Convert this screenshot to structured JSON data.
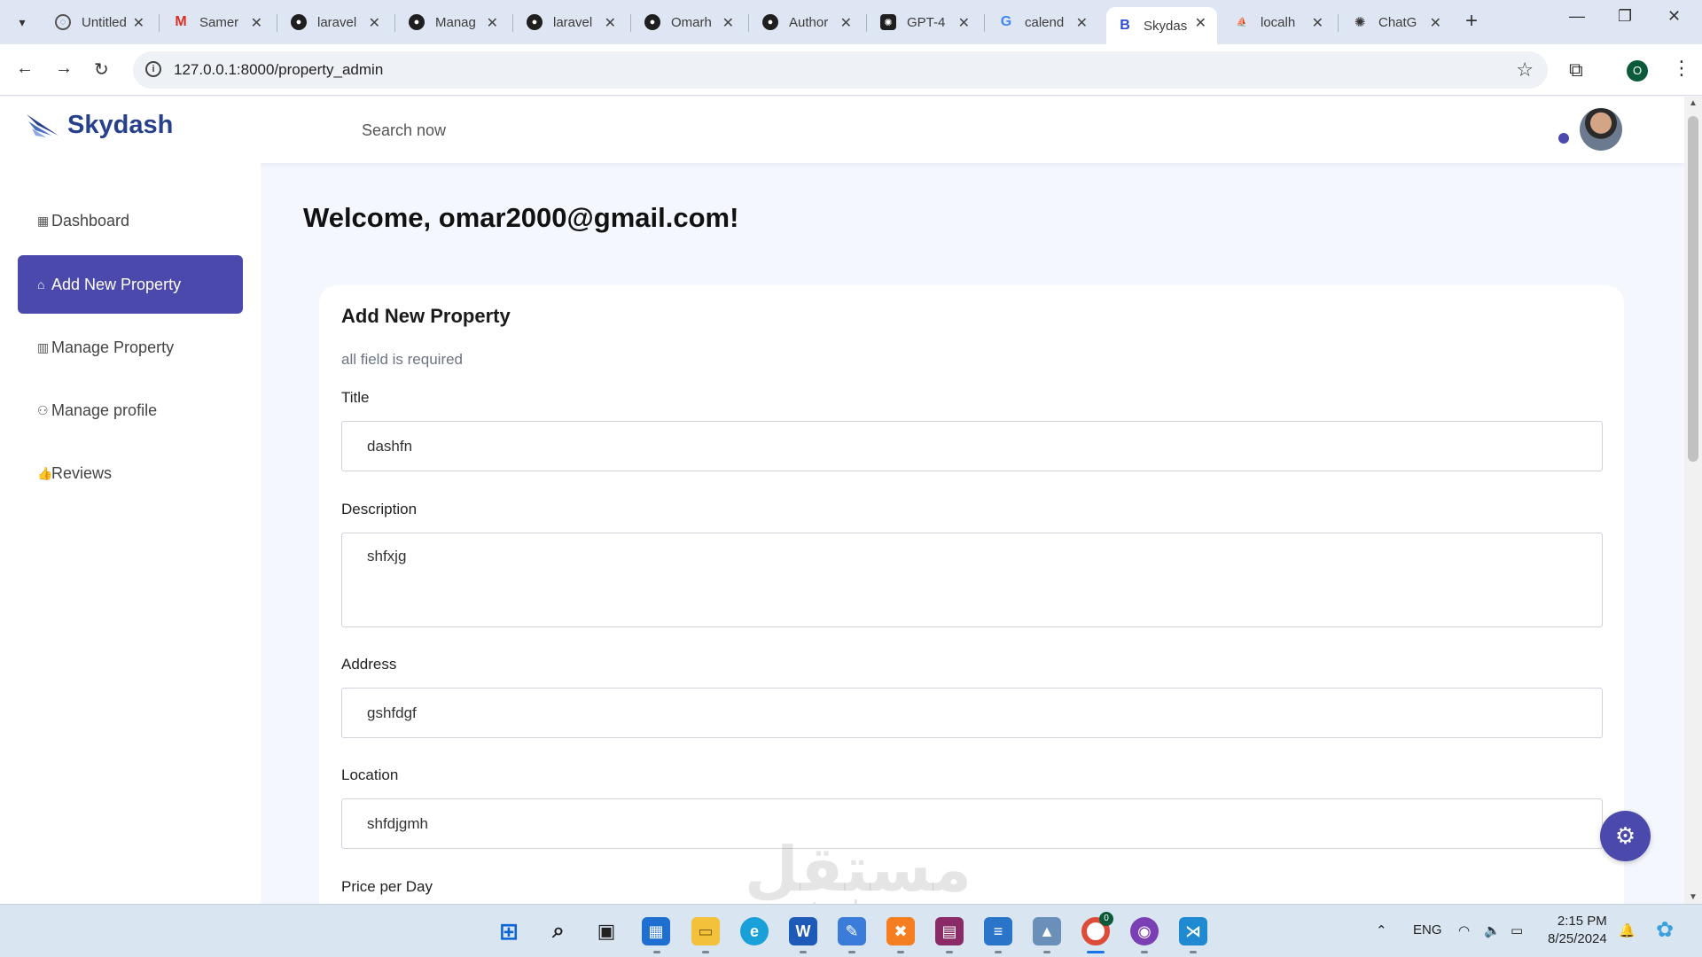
{
  "browser": {
    "tabs": [
      {
        "label": "Untitled",
        "icon": "page-icon"
      },
      {
        "label": "Samer",
        "icon": "gmail-icon"
      },
      {
        "label": "laravel",
        "icon": "github-icon"
      },
      {
        "label": "Manag",
        "icon": "github-icon"
      },
      {
        "label": "laravel",
        "icon": "github-icon"
      },
      {
        "label": "Omarh",
        "icon": "github-icon"
      },
      {
        "label": "Author",
        "icon": "github-icon"
      },
      {
        "label": "GPT-4",
        "icon": "openai-icon"
      },
      {
        "label": "calend",
        "icon": "google-icon"
      },
      {
        "label": "Skydas",
        "icon": "bootstrap-icon",
        "active": true
      },
      {
        "label": "localh",
        "icon": "phpmyadmin-icon"
      },
      {
        "label": "ChatG",
        "icon": "openai-icon"
      }
    ],
    "url": "127.0.0.1:8000/property_admin",
    "profile_initial": "O"
  },
  "app": {
    "brand": "Skydash",
    "search_placeholder": "Search now",
    "accent": "#4b49ac"
  },
  "sidebar": {
    "items": [
      {
        "label": "Dashboard",
        "icon": "grid-icon"
      },
      {
        "label": "Add New Property",
        "icon": "home-icon",
        "active": true
      },
      {
        "label": "Manage Property",
        "icon": "building-icon"
      },
      {
        "label": "Manage profile",
        "icon": "users-icon"
      },
      {
        "label": "Reviews",
        "icon": "thumbs-up-icon"
      }
    ]
  },
  "main": {
    "welcome": "Welcome, omar2000@gmail.com!",
    "form": {
      "title": "Add New Property",
      "subtitle": "all field is required",
      "fields": {
        "title": {
          "label": "Title",
          "value": "dashfn"
        },
        "description": {
          "label": "Description",
          "value": "shfxjg"
        },
        "address": {
          "label": "Address",
          "value": "gshfdgf"
        },
        "location": {
          "label": "Location",
          "value": "shfdjgmh"
        },
        "price": {
          "label": "Price per Day"
        }
      }
    }
  },
  "watermark": {
    "text": "مستقل",
    "sub": "mostaql.com"
  },
  "taskbar": {
    "language": "ENG",
    "time": "2:15 PM",
    "date": "8/25/2024",
    "chrome_badge": "0"
  }
}
